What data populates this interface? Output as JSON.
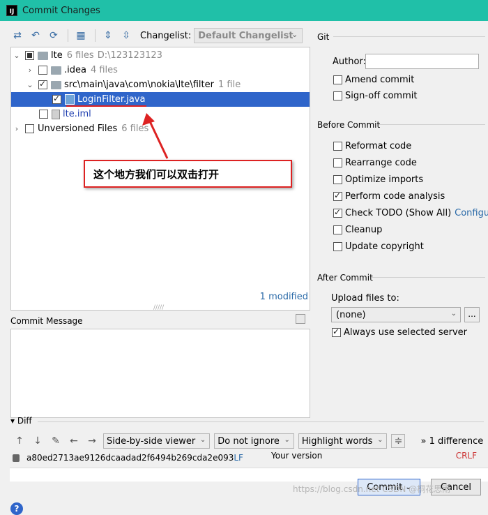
{
  "window": {
    "title": "Commit Changes"
  },
  "toolbar": {
    "changelist_label": "Changelist:",
    "changelist_value": "Default Changelist"
  },
  "tree": {
    "root": {
      "name": "lte",
      "count": "6 files",
      "path": "D:\\123123123"
    },
    "idea": {
      "name": ".idea",
      "count": "4 files"
    },
    "src": {
      "name": "src\\main\\java\\com\\nokia\\lte\\filter",
      "count": "1 file"
    },
    "file": {
      "name": "LoginFilter.java"
    },
    "iml": {
      "name": "lte.iml"
    },
    "unversioned": {
      "name": "Unversioned Files",
      "count": "6 files"
    },
    "modified": "1 modified"
  },
  "commit_message": {
    "label": "Commit Message"
  },
  "annotation": {
    "text": "这个地方我们可以双击打开"
  },
  "git": {
    "section": "Git",
    "author_label": "Author:",
    "amend": "Amend commit",
    "signoff": "Sign-off commit"
  },
  "before_commit": {
    "title": "Before Commit",
    "options": [
      {
        "label": "Reformat code",
        "checked": false
      },
      {
        "label": "Rearrange code",
        "checked": false
      },
      {
        "label": "Optimize imports",
        "checked": false
      },
      {
        "label": "Perform code analysis",
        "checked": true
      },
      {
        "label": "Check TODO (Show All)",
        "checked": true
      },
      {
        "label": "Cleanup",
        "checked": false
      },
      {
        "label": "Update copyright",
        "checked": false
      }
    ],
    "configure_link": "Configure"
  },
  "after_commit": {
    "title": "After Commit",
    "upload_label": "Upload files to:",
    "upload_value": "(none)",
    "always_use": "Always use selected server",
    "dots": "..."
  },
  "diff": {
    "label": "Diff",
    "viewer": "Side-by-side viewer",
    "ignore": "Do not ignore",
    "highlight": "Highlight words",
    "count": "1 difference",
    "hash": "a80ed2713ae9126dcaadad2f6494b269cda2e093",
    "lf": "LF",
    "your_version": "Your version",
    "crlf": "CRLF"
  },
  "buttons": {
    "commit": "Commit",
    "cancel": "Cancel",
    "help": "?"
  },
  "watermark": "https://blog.csdn.net CSDN @桐花思雨"
}
